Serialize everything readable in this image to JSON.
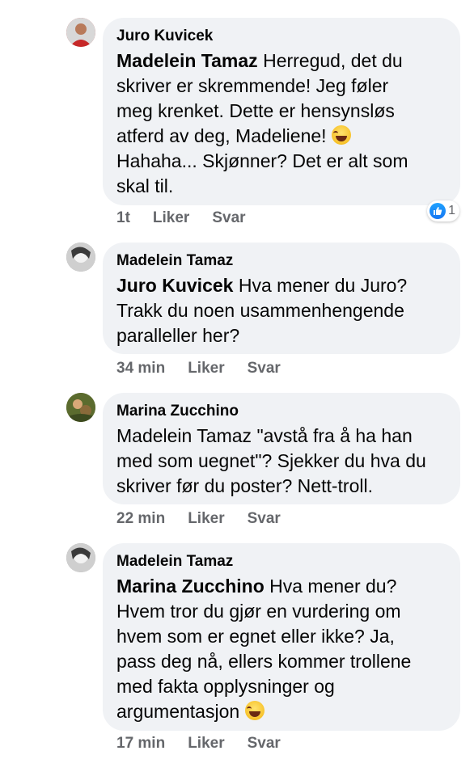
{
  "comments": [
    {
      "author": "Juro Kuvicek",
      "mention": "Madelein Tamaz",
      "text": " Herregud, det du\nskriver er skremmende! Jeg føler\nmeg krenket. Dette er hensynsløs\natferd av deg, Madeliene! ",
      "text2": "\nHahaha... Skjønner? Det er alt som\nskal til.",
      "time": "1t",
      "like_label": "Liker",
      "reply_label": "Svar",
      "reaction_count": "1",
      "avatar_color": "#c94545"
    },
    {
      "author": "Madelein Tamaz",
      "mention": "Juro Kuvicek",
      "text": " Hva mener du Juro?\nTrakk du noen usammenhengende\nparalleller her?",
      "time": "34 min",
      "like_label": "Liker",
      "reply_label": "Svar",
      "avatar_color": "#9a9a9a"
    },
    {
      "author": "Marina Zucchino",
      "text": "Madelein Tamaz \"avstå fra å ha han\nmed som uegnet\"? Sjekker du hva du\nskriver før du poster? Nett-troll.",
      "time": "22 min",
      "like_label": "Liker",
      "reply_label": "Svar",
      "avatar_color": "#6b7a3a"
    },
    {
      "author": "Madelein Tamaz",
      "mention": "Marina Zucchino",
      "text": " Hva mener du?\nHvem tror du gjør en vurdering om\nhvem som er egnet eller ikke? Ja,\npass deg nå, ellers kommer trollene\nmed fakta opplysninger og\nargumentasjon ",
      "time": "17 min",
      "like_label": "Liker",
      "reply_label": "Svar",
      "avatar_color": "#9a9a9a"
    }
  ],
  "icons": {
    "emoji": "joy-emoji-icon",
    "reaction": "like-reaction-icon"
  },
  "colors": {
    "bubble": "#f0f2f5",
    "meta_text": "#65676b",
    "like_blue": "#1877f2"
  }
}
